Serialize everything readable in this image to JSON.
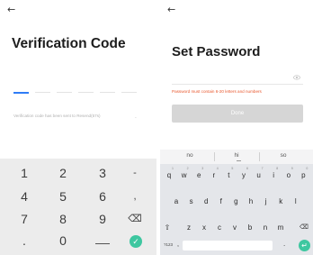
{
  "left_screen": {
    "back_glyph": "←",
    "title": "Verification Code",
    "sent_note": "Verification code has been sent to Resend(57s)",
    "resend_marker": "-",
    "numpad": {
      "row1": [
        "1",
        "2",
        "3",
        "-"
      ],
      "row2": [
        "4",
        "5",
        "6",
        ","
      ],
      "row3": [
        "7",
        "8",
        "9",
        "⌫"
      ],
      "row4_left": ".",
      "row4_zero": "0",
      "confirm_glyph": "✓"
    }
  },
  "right_screen": {
    "back_glyph": "←",
    "title": "Set Password",
    "password_value": "",
    "hint": "Password must contain 6-20 letters and numbers",
    "done_label": "Done",
    "keyboard": {
      "suggestions": [
        "no",
        "hi",
        "so"
      ],
      "row1": [
        "q",
        "w",
        "e",
        "r",
        "t",
        "y",
        "u",
        "i",
        "o",
        "p"
      ],
      "row1_hints": [
        "1",
        "2",
        "3",
        "4",
        "5",
        "6",
        "7",
        "8",
        "9",
        "0"
      ],
      "row2": [
        "a",
        "s",
        "d",
        "f",
        "g",
        "h",
        "j",
        "k",
        "l"
      ],
      "row3": [
        "z",
        "x",
        "c",
        "v",
        "b",
        "n",
        "m"
      ],
      "shift_glyph": "⇧",
      "backspace_glyph": "⌫",
      "mode_label": "?123",
      "comma": ",",
      "period": ".",
      "enter_glyph": "↵"
    }
  },
  "colors": {
    "accent_blue": "#2f7cf6",
    "confirm_green": "#3ec7a0",
    "hint_orange": "#e8572d",
    "done_disabled": "#d6d6d6"
  }
}
